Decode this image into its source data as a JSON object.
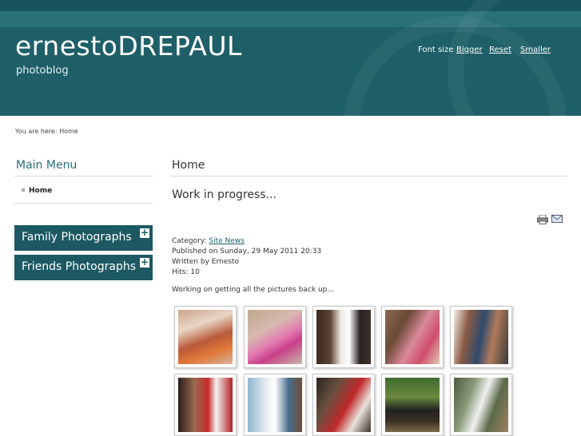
{
  "header": {
    "site_title": "ernestoDREPAUL",
    "subtitle": "photoblog",
    "font_size_label": "Font size",
    "bigger": "Bigger",
    "reset": "Reset",
    "smaller": "Smaller"
  },
  "breadcrumb": "You are here: Home",
  "main_menu": {
    "title": "Main Menu",
    "items": [
      "Home"
    ]
  },
  "categories": [
    "Family Photographs",
    "Friends Photographs"
  ],
  "content": {
    "page_title": "Home",
    "article_title": "Work in progress...",
    "category_label": "Category: ",
    "category_link": "Site News",
    "published": "Published on Sunday, 29 May 2011 20:33",
    "written_by": "Written by Ernesto",
    "hits": "Hits: 10",
    "body": "Working on getting all the pictures back up..."
  },
  "colors": {
    "header_bg": "#1e5f68",
    "accent": "#2a6f7a",
    "category_bar": "#1c5962"
  },
  "icons": [
    "print-icon",
    "email-icon"
  ]
}
